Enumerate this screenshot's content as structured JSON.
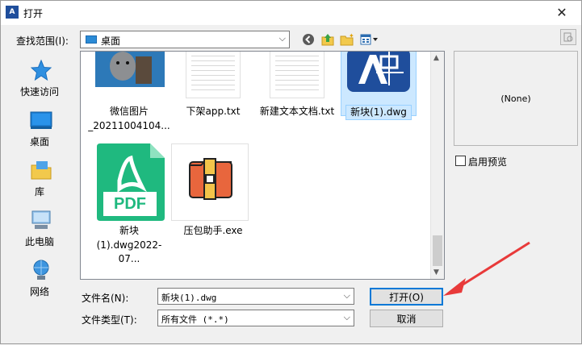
{
  "window": {
    "title": "打开",
    "app_icon": "A",
    "close_glyph": "✕"
  },
  "toolbar": {
    "look_in_label": "查找范围(I):",
    "look_in_value": "桌面",
    "icons": [
      "back-icon",
      "up-folder-icon",
      "new-folder-icon",
      "views-icon"
    ],
    "tools_icon": "tools-icon"
  },
  "places": [
    {
      "label": "快速访问",
      "icon": "star-icon"
    },
    {
      "label": "桌面",
      "icon": "desktop-icon"
    },
    {
      "label": "库",
      "icon": "library-icon"
    },
    {
      "label": "此电脑",
      "icon": "computer-icon"
    },
    {
      "label": "网络",
      "icon": "network-icon"
    }
  ],
  "files": [
    {
      "name_line1": "微信图片",
      "name_line2": "_20211004104...",
      "kind": "photo"
    },
    {
      "name_line1": "下架app.txt",
      "name_line2": "",
      "kind": "txt"
    },
    {
      "name_line1": "新建文本文档.txt",
      "name_line2": "",
      "kind": "txt"
    },
    {
      "name_line1": "新块(1).dwg",
      "name_line2": "",
      "kind": "dwg",
      "selected": true
    },
    {
      "name_line1": "新块",
      "name_line2": "(1).dwg2022-07...",
      "kind": "pdf",
      "badge": "PDF"
    },
    {
      "name_line1": "压包助手.exe",
      "name_line2": "",
      "kind": "exe"
    }
  ],
  "form": {
    "filename_label": "文件名(N):",
    "filename_value": "新块(1).dwg",
    "filetype_label": "文件类型(T):",
    "filetype_value": "所有文件 (*.*)",
    "open_label": "打开(O)",
    "cancel_label": "取消"
  },
  "preview": {
    "text": "(None)",
    "enable_label": "启用预览",
    "enabled": false
  },
  "colors": {
    "accent": "#0078d7",
    "pdf_green": "#1fb97f",
    "arrow_red": "#e83a3a",
    "dwg_blue": "#1f4e9c"
  }
}
